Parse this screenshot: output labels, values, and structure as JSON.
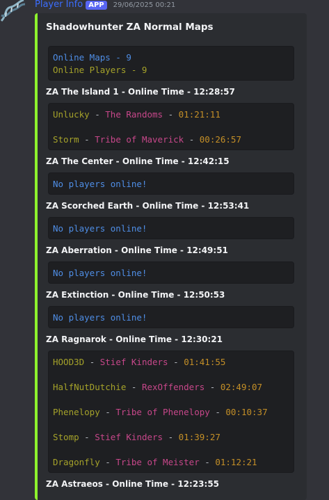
{
  "message": {
    "username": "Player Info",
    "app_badge": "APP",
    "timestamp": "29/06/2025 00:21",
    "avatar_icon": "dna-helix-icon",
    "accent_color": "#8df22d"
  },
  "embed": {
    "title": "Shadowhunter ZA Normal Maps",
    "summary": {
      "maps_line": "Online Maps - 9",
      "players_line": "Online Players - 9"
    },
    "separator": "-",
    "fields": [
      {
        "title": "ZA The Island 1 - Online Time - 12:28:57",
        "players": [
          {
            "name": "Unlucky",
            "tribe": "The Randoms",
            "time": "01:21:11"
          },
          {
            "name": "Storm",
            "tribe": "Tribe of Maverick",
            "time": "00:26:57"
          }
        ]
      },
      {
        "title": "ZA The Center - Online Time - 12:42:15",
        "empty_text": "No players online!"
      },
      {
        "title": "ZA Scorched Earth - Online Time - 12:53:41",
        "empty_text": "No players online!"
      },
      {
        "title": "ZA Aberration - Online Time - 12:49:51",
        "empty_text": "No players online!"
      },
      {
        "title": "ZA Extinction - Online Time - 12:50:53",
        "empty_text": "No players online!"
      },
      {
        "title": "ZA Ragnarok - Online Time - 12:30:21",
        "players": [
          {
            "name": "HOOD3D",
            "tribe": "Stief Kinders",
            "time": "01:41:55"
          },
          {
            "name": "HalfNutDutchie",
            "tribe": "RexOffenders",
            "time": "02:49:07"
          },
          {
            "name": "Phenelopy",
            "tribe": "Tribe of Phenelopy",
            "time": "00:10:37"
          },
          {
            "name": "Stomp",
            "tribe": "Stief Kinders",
            "time": "01:39:27"
          },
          {
            "name": "Dragonfly",
            "tribe": "Tribe of Meister",
            "time": "01:12:21"
          }
        ]
      },
      {
        "title": "ZA Astraeos - Online Time - 12:23:55"
      }
    ]
  }
}
